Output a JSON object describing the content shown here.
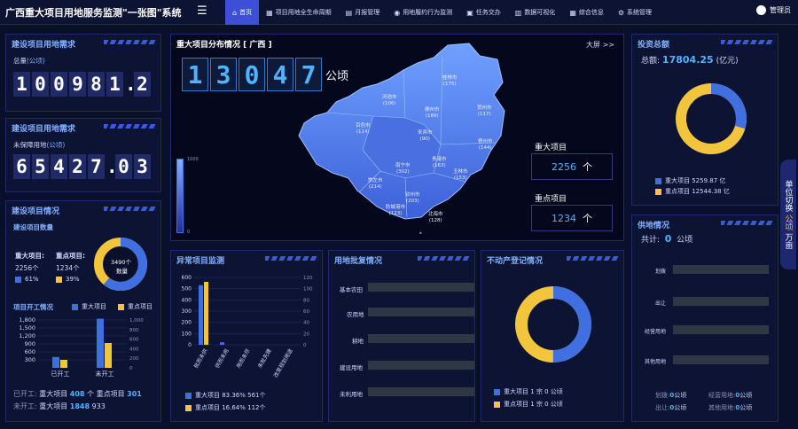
{
  "app": {
    "title": "广西重大项目用地服务监测\"一张图\"系统",
    "user": "管理员"
  },
  "nav": [
    {
      "label": "首页",
      "icon": "⌂"
    },
    {
      "label": "项目用地全生命周期",
      "icon": "▦"
    },
    {
      "label": "月报管理",
      "icon": "▤"
    },
    {
      "label": "用地履约行为监测",
      "icon": "◉"
    },
    {
      "label": "任务交办",
      "icon": "▣"
    },
    {
      "label": "数据可视化",
      "icon": "▥"
    },
    {
      "label": "综合信息",
      "icon": "▦"
    },
    {
      "label": "系统管理",
      "icon": "⚙"
    }
  ],
  "need1": {
    "title": "建设项目用地需求",
    "label": "总量",
    "unit": "(公顷)",
    "digits": [
      "1",
      "0",
      "0",
      "9",
      "8",
      "1",
      ".",
      "2"
    ]
  },
  "need2": {
    "title": "建设项目用地需求",
    "label": "未保障用地",
    "unit": "(公顷)",
    "digits": [
      "6",
      "5",
      "4",
      "2",
      "7",
      ".",
      "0",
      "3"
    ]
  },
  "projects": {
    "title": "建设项目情况",
    "count_title": "建设项目数量",
    "major_label": "重大项目:",
    "key_label": "重点项目:",
    "major_count": "2256个",
    "key_count": "1234个",
    "major_pct": "61%",
    "key_pct": "39%",
    "donut_total": "3490个",
    "donut_sub": "数量",
    "start_title": "项目开工情况",
    "legend_major": "重大项目",
    "legend_key": "重点项目",
    "started_line": [
      "已开工:",
      "重大项目",
      "408",
      "个 重点项目",
      "301"
    ],
    "unstarted_line": [
      "未开工:",
      "重大项目",
      "1848",
      "933"
    ]
  },
  "open_chart": {
    "categories": [
      "已开工",
      "未开工"
    ],
    "series": [
      {
        "name": "重大项目",
        "values": [
          408,
          1848
        ]
      },
      {
        "name": "重点项目",
        "values": [
          301,
          933
        ]
      }
    ],
    "yticks": [
      300,
      600,
      900,
      1200,
      1500,
      1800
    ],
    "y2ticks": [
      0,
      200,
      400,
      600,
      800,
      1000
    ]
  },
  "map": {
    "title": "重大项目分布情况 [ 广西 ]",
    "fullscreen": "大屏 >>",
    "total_digits": [
      "1",
      "3",
      "0",
      "4",
      "7"
    ],
    "total_unit": "公顷",
    "scale_top": "1000",
    "scale_bottom": "0",
    "dot": "•",
    "cities": [
      {
        "name": "桂林市",
        "n": "(175)"
      },
      {
        "name": "河池市",
        "n": "(106)"
      },
      {
        "name": "柳州市",
        "n": "(189)"
      },
      {
        "name": "贺州市",
        "n": "(117)"
      },
      {
        "name": "百色市",
        "n": "(114)"
      },
      {
        "name": "来宾市",
        "n": "(90)"
      },
      {
        "name": "梧州市",
        "n": "(144)"
      },
      {
        "name": "南宁市",
        "n": "(302)"
      },
      {
        "name": "贵港市",
        "n": "(163)"
      },
      {
        "name": "玉林市",
        "n": "(153)"
      },
      {
        "name": "崇左市",
        "n": "(214)"
      },
      {
        "name": "钦州市",
        "n": "(203)"
      },
      {
        "name": "防城港市",
        "n": "(123)"
      },
      {
        "name": "北海市",
        "n": "(128)"
      }
    ],
    "major_label": "重大项目",
    "major_value": "2256",
    "key_label": "重点项目",
    "key_value": "1234",
    "unit": "个"
  },
  "abnormal": {
    "title": "异常项目监测",
    "legend": [
      {
        "label": "重大项目 83.36% 561个"
      },
      {
        "label": "重点项目 16.64% 112个"
      }
    ]
  },
  "abn_chart": {
    "categories": [
      "批而未供",
      "供而未用",
      "用而未尽",
      "未批先建",
      "改变规划用途"
    ],
    "series": [
      {
        "name": "重大项目",
        "values": [
          531,
          22,
          0,
          0,
          0
        ]
      },
      {
        "name": "重点项目",
        "values": [
          561,
          0,
          0,
          0,
          0
        ]
      }
    ],
    "yticks": [
      0,
      100,
      200,
      300,
      400,
      500,
      600
    ],
    "y2ticks": [
      0,
      20,
      40,
      60,
      80,
      100,
      120
    ]
  },
  "approval": {
    "title": "用地批复情况",
    "rows": [
      "基本农田",
      "农用地",
      "耕地",
      "建设用地",
      "未利用地"
    ]
  },
  "realestate": {
    "title": "不动产登记情况",
    "legend": [
      {
        "label": "重大项目 1 宗 0 公顷"
      },
      {
        "label": "重点项目 1 宗 0 公顷"
      }
    ]
  },
  "invest": {
    "title": "投资总额",
    "label": "总额:",
    "value": "17804.25",
    "unit": "(亿元)",
    "legend": [
      {
        "label": "重大项目 5259.87 亿"
      },
      {
        "label": "重点项目 12544.38 亿"
      }
    ],
    "shares": [
      29.5,
      70.5
    ]
  },
  "supply": {
    "title": "供地情况",
    "label": "共计:",
    "value": "0",
    "unit": "公顷",
    "rows": [
      "划拨",
      "出让",
      "经营用地",
      "其他用地"
    ],
    "stats": [
      {
        "label": "划拨:",
        "value": "0",
        "unit": "公顷"
      },
      {
        "label": "经营用地:",
        "value": "0",
        "unit": "公顷"
      },
      {
        "label": "出让:",
        "value": "0",
        "unit": "公顷"
      },
      {
        "label": "其他用地:",
        "value": "0",
        "unit": "公顷"
      }
    ]
  },
  "side_tab": {
    "text": "单位切换",
    "opt1": "公顷",
    "opt2": "万亩"
  },
  "colors": {
    "blue": "#3f6fe0",
    "yellow": "#f2c53d",
    "accent": "#3d4fd6"
  }
}
